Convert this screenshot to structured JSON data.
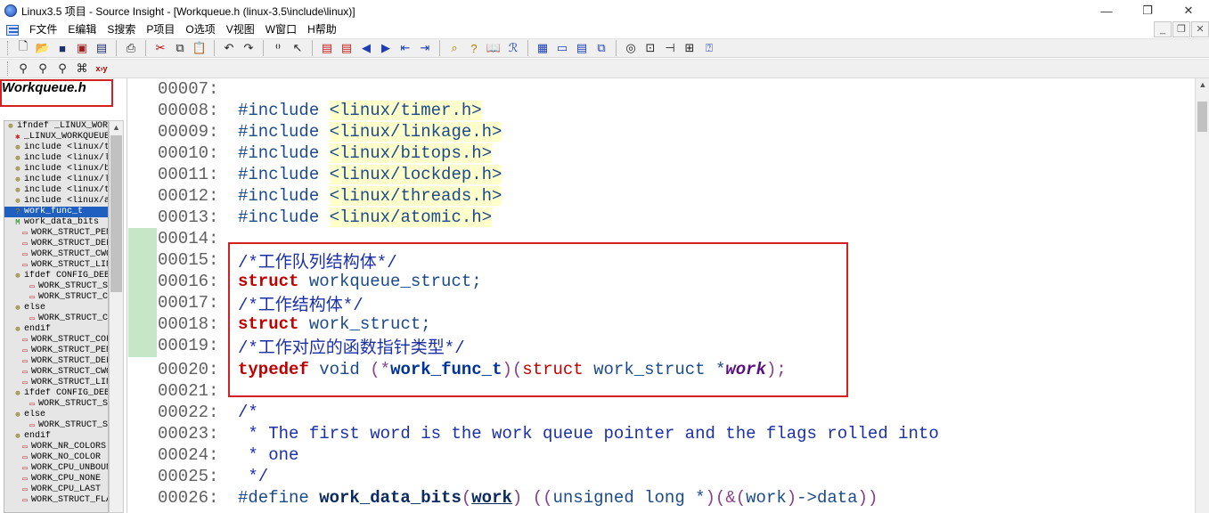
{
  "window": {
    "title": "Linux3.5 项目 - Source Insight - [Workqueue.h (linux-3.5\\include\\linux)]",
    "minimize": "—",
    "restore": "❐",
    "close": "✕"
  },
  "menu": {
    "items": [
      "F文件",
      "E编辑",
      "S搜索",
      "P项目",
      "O选项",
      "V视图",
      "W窗口",
      "H帮助"
    ],
    "mdi_buttons": [
      "_",
      "❐",
      "✕"
    ]
  },
  "sidebar": {
    "file_title": "Workqueue.h",
    "symbols": [
      {
        "icon": "include",
        "text": "ifndef _LINUX_WORKQUEUE_H",
        "indent": 0
      },
      {
        "icon": "macro",
        "text": "_LINUX_WORKQUEUE_H",
        "indent": 1
      },
      {
        "icon": "include",
        "text": "include <linux/timer.h>",
        "indent": 1
      },
      {
        "icon": "include",
        "text": "include <linux/linkage.h>",
        "indent": 1
      },
      {
        "icon": "include",
        "text": "include <linux/bitops.h>",
        "indent": 1
      },
      {
        "icon": "include",
        "text": "include <linux/lockdep.h>",
        "indent": 1
      },
      {
        "icon": "include",
        "text": "include <linux/threads.h>",
        "indent": 1
      },
      {
        "icon": "include",
        "text": "include <linux/atomic.h>",
        "indent": 1
      },
      {
        "icon": "type",
        "text": "work_func_t",
        "indent": 1,
        "selected": true
      },
      {
        "icon": "struct",
        "text": "work_data_bits",
        "indent": 1
      },
      {
        "icon": "enum",
        "text": "WORK_STRUCT_PENDING_BIT",
        "indent": 2
      },
      {
        "icon": "enum",
        "text": "WORK_STRUCT_DELAYED_BIT",
        "indent": 2
      },
      {
        "icon": "enum",
        "text": "WORK_STRUCT_CWQ_BIT",
        "indent": 2
      },
      {
        "icon": "enum",
        "text": "WORK_STRUCT_LINKED_BIT",
        "indent": 2
      },
      {
        "icon": "include",
        "text": "ifdef CONFIG_DEBUG_OBJECTS_WORK",
        "indent": 1
      },
      {
        "icon": "enum",
        "text": "WORK_STRUCT_STATIC_BIT",
        "indent": 3
      },
      {
        "icon": "enum",
        "text": "WORK_STRUCT_COLOR_SHIFT",
        "indent": 3
      },
      {
        "icon": "include",
        "text": "else",
        "indent": 1
      },
      {
        "icon": "enum",
        "text": "WORK_STRUCT_COLOR_SHIFT",
        "indent": 3
      },
      {
        "icon": "include",
        "text": "endif",
        "indent": 1
      },
      {
        "icon": "enum",
        "text": "WORK_STRUCT_COLOR_BITS",
        "indent": 2
      },
      {
        "icon": "enum",
        "text": "WORK_STRUCT_PENDING",
        "indent": 2
      },
      {
        "icon": "enum",
        "text": "WORK_STRUCT_DELAYED",
        "indent": 2
      },
      {
        "icon": "enum",
        "text": "WORK_STRUCT_CWQ",
        "indent": 2
      },
      {
        "icon": "enum",
        "text": "WORK_STRUCT_LINKED",
        "indent": 2
      },
      {
        "icon": "include",
        "text": "ifdef CONFIG_DEBUG_OBJECTS_WORK",
        "indent": 1
      },
      {
        "icon": "enum",
        "text": "WORK_STRUCT_STATIC",
        "indent": 3
      },
      {
        "icon": "include",
        "text": "else",
        "indent": 1
      },
      {
        "icon": "enum",
        "text": "WORK_STRUCT_STATIC",
        "indent": 3
      },
      {
        "icon": "include",
        "text": "endif",
        "indent": 1
      },
      {
        "icon": "enum",
        "text": "WORK_NR_COLORS",
        "indent": 2
      },
      {
        "icon": "enum",
        "text": "WORK_NO_COLOR",
        "indent": 2
      },
      {
        "icon": "enum",
        "text": "WORK_CPU_UNBOUND",
        "indent": 2
      },
      {
        "icon": "enum",
        "text": "WORK_CPU_NONE",
        "indent": 2
      },
      {
        "icon": "enum",
        "text": "WORK_CPU_LAST",
        "indent": 2
      },
      {
        "icon": "enum",
        "text": "WORK_STRUCT_FLAG_BITS",
        "indent": 2
      }
    ]
  },
  "editor": {
    "lines": [
      {
        "num": "00007:",
        "parts": []
      },
      {
        "num": "00008:",
        "parts": [
          {
            "c": "kw-pre",
            "t": "#include "
          },
          {
            "c": "incl",
            "t": "<linux/timer.h>"
          }
        ]
      },
      {
        "num": "00009:",
        "parts": [
          {
            "c": "kw-pre",
            "t": "#include "
          },
          {
            "c": "incl",
            "t": "<linux/linkage.h>"
          }
        ]
      },
      {
        "num": "00010:",
        "parts": [
          {
            "c": "kw-pre",
            "t": "#include "
          },
          {
            "c": "incl",
            "t": "<linux/bitops.h>"
          }
        ]
      },
      {
        "num": "00011:",
        "parts": [
          {
            "c": "kw-pre",
            "t": "#include "
          },
          {
            "c": "incl",
            "t": "<linux/lockdep.h>"
          }
        ]
      },
      {
        "num": "00012:",
        "parts": [
          {
            "c": "kw-pre",
            "t": "#include "
          },
          {
            "c": "incl",
            "t": "<linux/threads.h>"
          }
        ]
      },
      {
        "num": "00013:",
        "parts": [
          {
            "c": "kw-pre",
            "t": "#include "
          },
          {
            "c": "incl",
            "t": "<linux/atomic.h>"
          }
        ]
      },
      {
        "num": "00014:",
        "parts": []
      },
      {
        "num": "00015:",
        "parts": [
          {
            "c": "comment",
            "t": "/*工作队列结构体*/"
          }
        ]
      },
      {
        "num": "00016:",
        "parts": [
          {
            "c": "kw",
            "t": "struct"
          },
          {
            "c": "ident",
            "t": " workqueue_struct;"
          }
        ]
      },
      {
        "num": "00017:",
        "parts": [
          {
            "c": "comment",
            "t": "/*工作结构体*/"
          }
        ]
      },
      {
        "num": "00018:",
        "parts": [
          {
            "c": "kw",
            "t": "struct"
          },
          {
            "c": "ident",
            "t": " work_struct;"
          }
        ]
      },
      {
        "num": "00019:",
        "parts": [
          {
            "c": "comment",
            "t": "/*工作对应的函数指针类型*/"
          }
        ]
      },
      {
        "num": "00020:",
        "parts": [
          {
            "c": "kw",
            "t": "typedef"
          },
          {
            "c": "ident",
            "t": " void "
          },
          {
            "c": "paren",
            "t": "(*"
          },
          {
            "c": "fname",
            "t": "work_func_t"
          },
          {
            "c": "paren",
            "t": ")("
          },
          {
            "c": "kw-light",
            "t": "struct"
          },
          {
            "c": "ident",
            "t": " work_struct *"
          },
          {
            "c": "param",
            "t": "work"
          },
          {
            "c": "paren",
            "t": ");"
          }
        ]
      },
      {
        "num": "00021:",
        "parts": []
      },
      {
        "num": "00022:",
        "parts": [
          {
            "c": "comment",
            "t": "/*"
          }
        ]
      },
      {
        "num": "00023:",
        "parts": [
          {
            "c": "comment",
            "t": " * The first word is the work queue pointer and the flags rolled into"
          }
        ]
      },
      {
        "num": "00024:",
        "parts": [
          {
            "c": "comment",
            "t": " * one"
          }
        ]
      },
      {
        "num": "00025:",
        "parts": [
          {
            "c": "comment",
            "t": " */"
          }
        ]
      },
      {
        "num": "00026:",
        "parts": [
          {
            "c": "kw-pre",
            "t": "#define "
          },
          {
            "c": "macro-name",
            "t": "work_data_bits"
          },
          {
            "c": "paren",
            "t": "("
          },
          {
            "c": "ul",
            "t": "work"
          },
          {
            "c": "paren",
            "t": ")"
          },
          {
            "c": "ident",
            "t": " "
          },
          {
            "c": "paren",
            "t": "(("
          },
          {
            "c": "ident",
            "t": "unsigned long *"
          },
          {
            "c": "paren",
            "t": ")(&("
          },
          {
            "c": "ident",
            "t": "work"
          },
          {
            "c": "paren",
            "t": ")"
          },
          {
            "c": "ident",
            "t": "->data"
          },
          {
            "c": "paren",
            "t": "))"
          }
        ]
      }
    ]
  },
  "icons": {
    "toolbar1": [
      "new-file-icon",
      "open-file-icon",
      "save-icon",
      "save-all-icon",
      "save-as-icon",
      "print-icon",
      "cut-icon",
      "copy-icon",
      "paste-icon",
      "undo-icon",
      "redo-icon",
      "jump-icon",
      "pointer-icon",
      "bookmark-prev-icon",
      "bookmark-next-icon",
      "back-icon",
      "forward-icon",
      "list-prev-icon",
      "list-next-icon",
      "lookup-icon",
      "symbol-icon",
      "book-icon",
      "relation-icon",
      "layout1-icon",
      "layout2-icon",
      "layout3-icon",
      "layout4-icon",
      "ring-icon",
      "window-icon",
      "split-icon",
      "tree-icon",
      "help-icon"
    ],
    "toolbar2": [
      "search-icon",
      "search-files-icon",
      "search-project-icon",
      "replace-icon",
      "xy-icon"
    ]
  }
}
